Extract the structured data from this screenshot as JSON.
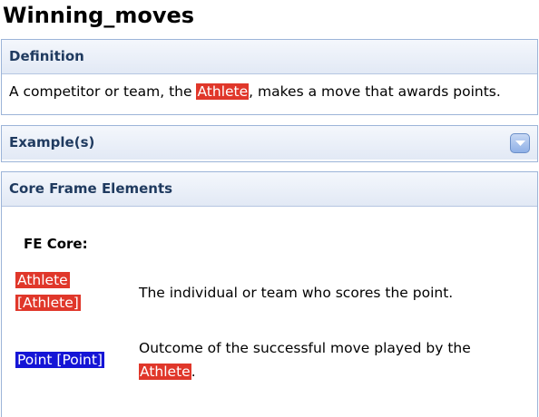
{
  "page": {
    "title": "Winning_moves"
  },
  "definition": {
    "header": "Definition",
    "text_before": "A competitor or team, the ",
    "fe_highlight": "Athlete",
    "text_after": ", makes a move that awards points."
  },
  "examples": {
    "header": "Example(s)",
    "expand_icon": "chevron-down-icon"
  },
  "core_elements": {
    "header": "Core Frame Elements",
    "subheader": "FE Core:",
    "items": [
      {
        "name_line1": "Athlete",
        "name_line2": "[Athlete]",
        "description": "The individual or team who scores the point.",
        "color": "#e0372a"
      },
      {
        "name": "Point [Point]",
        "description_before": "Outcome of the successful move played by the ",
        "description_highlight": "Athlete",
        "description_after": ".",
        "color": "#1515d6"
      }
    ]
  },
  "colors": {
    "athlete": "#e0372a",
    "point": "#1515d6",
    "header_text": "#1f3a5f",
    "panel_border": "#9cb4d8"
  }
}
